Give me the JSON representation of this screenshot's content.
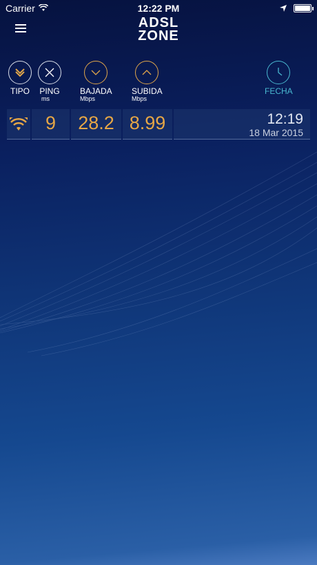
{
  "status_bar": {
    "carrier": "Carrier",
    "time": "12:22 PM",
    "battery_level": 1.0
  },
  "header": {
    "logo_line1": "ADSL",
    "logo_line2": "ZONE"
  },
  "columns": [
    {
      "label": "TIPO",
      "sub": "",
      "icon": "double-chevron-icon"
    },
    {
      "label": "PING",
      "sub": "ms",
      "icon": "x-icon"
    },
    {
      "label": "BAJADA",
      "sub": "Mbps",
      "icon": "chevron-down-icon"
    },
    {
      "label": "SUBIDA",
      "sub": "Mbps",
      "icon": "chevron-up-icon"
    },
    {
      "label": "FECHA",
      "sub": "",
      "icon": "clock-icon"
    }
  ],
  "results": [
    {
      "type_icon": "wifi-icon",
      "ping": "9",
      "download": "28.2",
      "upload": "8.99",
      "time": "12:19",
      "date": "18 Mar 2015"
    }
  ],
  "colors": {
    "accent_orange": "#e6a645",
    "accent_teal": "#49b8d0"
  }
}
